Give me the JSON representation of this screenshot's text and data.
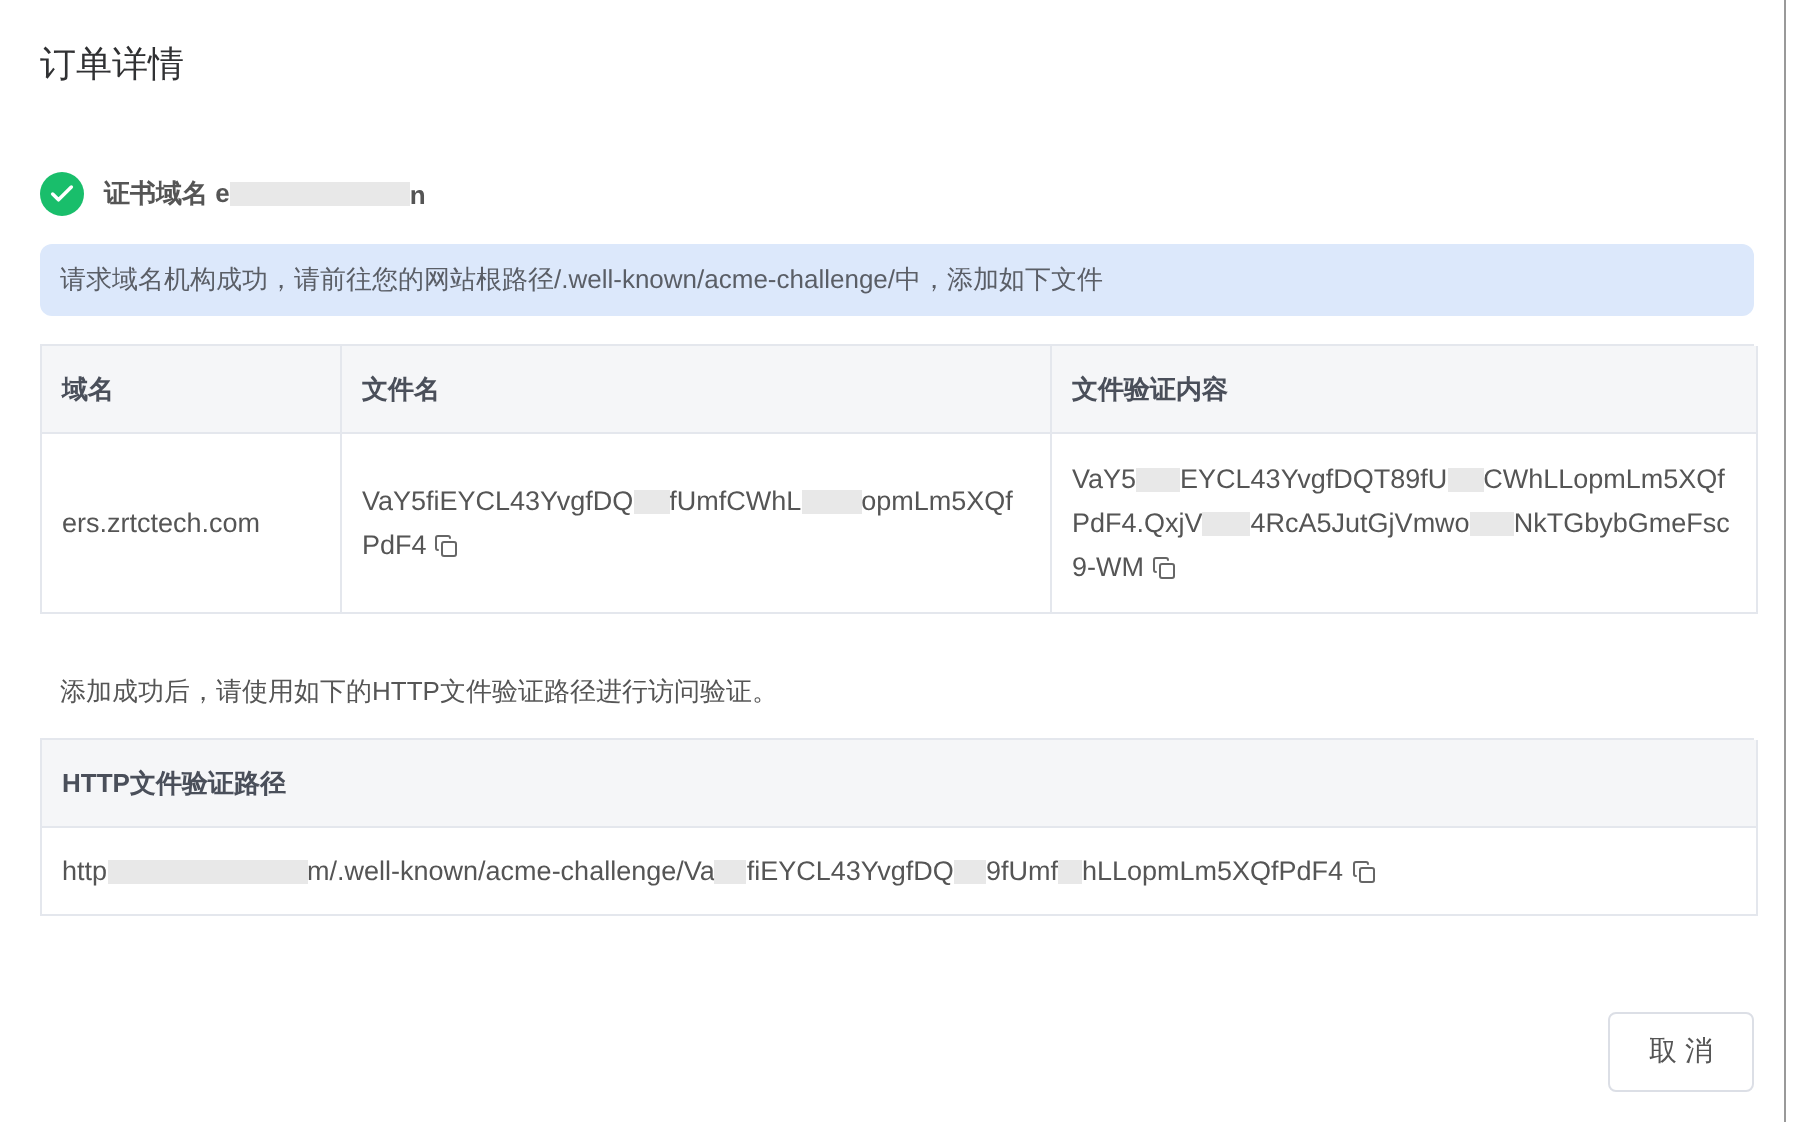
{
  "title": "订单详情",
  "domain_status": {
    "label": "证书域名",
    "value_parts": [
      "e",
      "n"
    ],
    "verified": true
  },
  "alert": "请求域名机构成功，请前往您的网站根路径/.well-known/acme-challenge/中，添加如下文件",
  "file_table": {
    "columns": [
      "域名",
      "文件名",
      "文件验证内容"
    ],
    "rows": [
      {
        "domain": [
          "ers.zrtctech.com"
        ],
        "file_name": [
          "VaY5fiEYCL43YvgfDQ",
          "fUmfCWhL",
          "opmLm5XQfPdF4"
        ],
        "content": [
          "VaY5",
          "EYCL43YvgfDQT89fU",
          "CWhLLopmLm5XQfPdF4.QxjV",
          "4RcA5JutGjVmwo",
          "NkTGbybGmeFsc9-WM"
        ]
      }
    ]
  },
  "hint": "添加成功后，请使用如下的HTTP文件验证路径进行访问验证。",
  "path_table": {
    "column": "HTTP文件验证路径",
    "value_parts": [
      "http",
      "m/.well-known/acme-challenge/Va",
      "fiEYCL43YvgfDQ",
      "9fUmf",
      "hLLopmLm5XQfPdF4"
    ]
  },
  "buttons": [
    "取 消"
  ]
}
